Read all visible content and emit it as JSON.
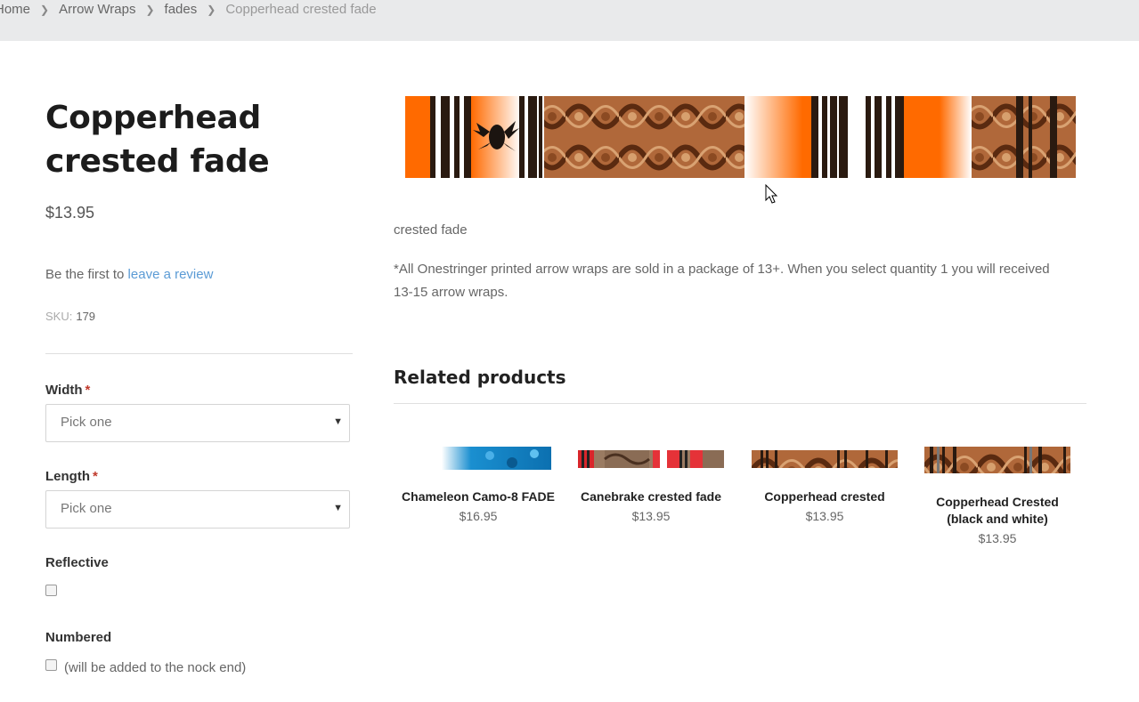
{
  "breadcrumb": {
    "items": [
      "Home",
      "Arrow Wraps",
      "fades"
    ],
    "current": "Copperhead crested fade"
  },
  "product": {
    "title": "Copperhead crested fade",
    "price": "$13.95",
    "review_prefix": "Be the first to",
    "review_link": "leave a review",
    "sku_label": "SKU:",
    "sku_value": "179",
    "short_desc": "crested fade",
    "long_desc": "*All Onestringer printed arrow wraps are sold in a package of 13+.  When you select quantity 1 you will received 13-15 arrow wraps."
  },
  "options": {
    "width_label": "Width",
    "width_value": "Pick one",
    "length_label": "Length",
    "length_value": "Pick one",
    "reflective_label": "Reflective",
    "numbered_label": "Numbered",
    "numbered_note": "(will be added to the nock end)",
    "required_mark": "*"
  },
  "related": {
    "heading": "Related products",
    "items": [
      {
        "name": "Chameleon Camo-8 FADE",
        "price": "$16.95"
      },
      {
        "name": "Canebrake crested fade",
        "price": "$13.95"
      },
      {
        "name": "Copperhead crested",
        "price": "$13.95"
      },
      {
        "name": "Copperhead Crested (black and white)",
        "price": "$13.95"
      }
    ]
  },
  "colors": {
    "link": "#5b9bd5",
    "orange": "#ff6a00",
    "required": "#c0392b"
  }
}
